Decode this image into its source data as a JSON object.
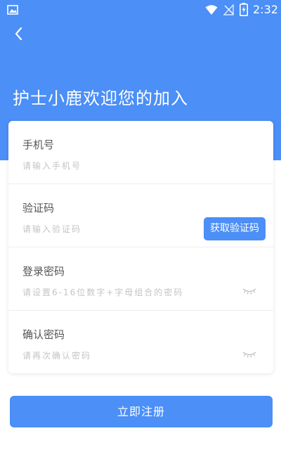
{
  "status_bar": {
    "time": "2:32",
    "icons": [
      "gallery-icon",
      "wifi-icon",
      "no-signal-icon",
      "battery-charging-icon"
    ]
  },
  "header": {
    "back_icon": "chevron-left-icon",
    "title": "护士小鹿欢迎您的加入"
  },
  "form": {
    "fields": [
      {
        "label": "手机号",
        "placeholder": "请输入手机号",
        "value": ""
      },
      {
        "label": "验证码",
        "placeholder": "请输入验证码",
        "value": "",
        "action_label": "获取验证码"
      },
      {
        "label": "登录密码",
        "placeholder": "请设置6-16位数字+字母组合的密码",
        "value": "",
        "icon": "eye-closed-icon"
      },
      {
        "label": "确认密码",
        "placeholder": "请再次确认密码",
        "value": "",
        "icon": "eye-closed-icon"
      }
    ]
  },
  "register_label": "立即注册",
  "colors": {
    "primary": "#4b8ff7",
    "background": "#ffffff",
    "label": "#555555",
    "placeholder": "#c4c4c4"
  }
}
